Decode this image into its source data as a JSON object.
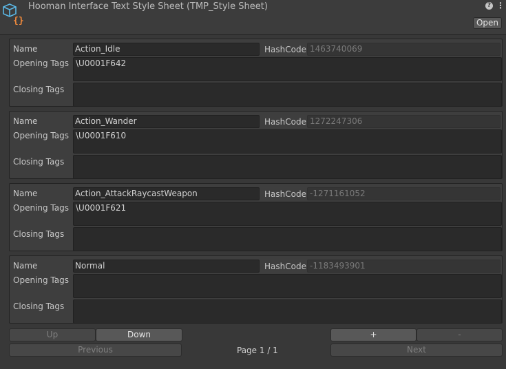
{
  "window": {
    "title": "Hooman Interface Text Style Sheet (TMP_Style Sheet)",
    "open_label": "Open",
    "help_glyph": "?",
    "menu_glyph": "⋮"
  },
  "fields": {
    "name_label": "Name",
    "hashcode_label": "HashCode",
    "opening_tags_label": "Opening Tags",
    "closing_tags_label": "Closing Tags"
  },
  "styles": [
    {
      "name": "Action_Idle",
      "hashcode": "1463740069",
      "opening_tags": "\\U0001F642",
      "closing_tags": ""
    },
    {
      "name": "Action_Wander",
      "hashcode": "1272247306",
      "opening_tags": "\\U0001F610",
      "closing_tags": ""
    },
    {
      "name": "Action_AttackRaycastWeapon",
      "hashcode": "-1271161052",
      "opening_tags": "\\U0001F621",
      "closing_tags": ""
    },
    {
      "name": "Normal",
      "hashcode": "-1183493901",
      "opening_tags": "",
      "closing_tags": ""
    }
  ],
  "controls": {
    "up_label": "Up",
    "down_label": "Down",
    "add_label": "+",
    "remove_label": "-",
    "previous_label": "Previous",
    "page_label": "Page 1 / 1",
    "next_label": "Next"
  },
  "colors": {
    "background": "#383838",
    "field": "#2a2a2a",
    "accent_orange": "#f08a3c",
    "icon_blue": "#5bb8e6"
  }
}
